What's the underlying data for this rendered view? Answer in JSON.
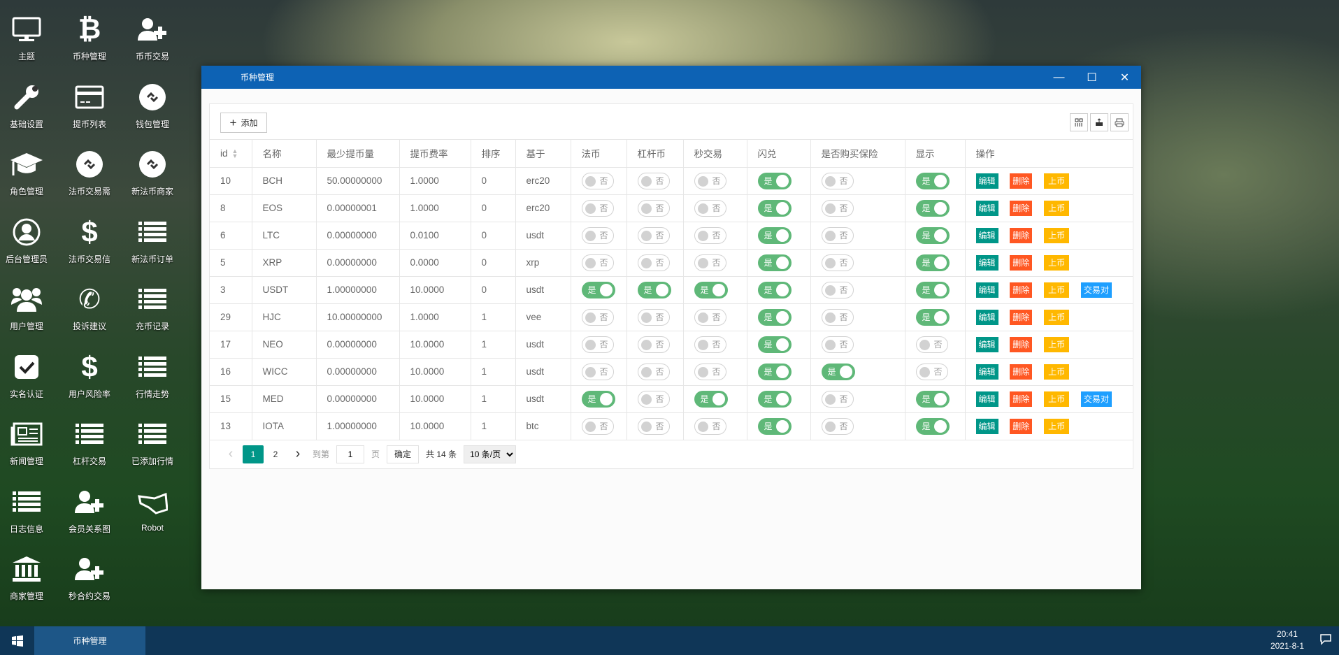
{
  "desktop": {
    "icons": [
      {
        "label": "主题",
        "icon": "monitor-icon"
      },
      {
        "label": "币种管理",
        "icon": "bitcoin-icon"
      },
      {
        "label": "币币交易",
        "icon": "user-plus-icon"
      },
      {
        "label": "基础设置",
        "icon": "wrench-icon"
      },
      {
        "label": "提币列表",
        "icon": "credit-card-icon"
      },
      {
        "label": "钱包管理",
        "icon": "link-circle-icon"
      },
      {
        "label": "角色管理",
        "icon": "graduation-cap-icon"
      },
      {
        "label": "法币交易需",
        "icon": "link-circle-icon"
      },
      {
        "label": "新法币商家",
        "icon": "link-circle-icon"
      },
      {
        "label": "后台管理员",
        "icon": "user-circle-icon"
      },
      {
        "label": "法币交易信",
        "icon": "dollar-icon"
      },
      {
        "label": "新法币订单",
        "icon": "list-icon"
      },
      {
        "label": "用户管理",
        "icon": "users-icon"
      },
      {
        "label": "投诉建议",
        "icon": "phone-icon"
      },
      {
        "label": "充币记录",
        "icon": "list-icon"
      },
      {
        "label": "实名认证",
        "icon": "check-square-icon"
      },
      {
        "label": "用户风险率",
        "icon": "dollar-icon"
      },
      {
        "label": "行情走势",
        "icon": "list-icon"
      },
      {
        "label": "新闻管理",
        "icon": "newspaper-icon"
      },
      {
        "label": "杠杆交易",
        "icon": "list-icon"
      },
      {
        "label": "已添加行情",
        "icon": "list-icon"
      },
      {
        "label": "日志信息",
        "icon": "list-icon"
      },
      {
        "label": "会员关系图",
        "icon": "user-plus-icon"
      },
      {
        "label": "Robot",
        "icon": "hand-icon"
      },
      {
        "label": "商家管理",
        "icon": "bank-icon"
      },
      {
        "label": "秒合约交易",
        "icon": "user-plus-icon"
      }
    ]
  },
  "window": {
    "title": "币种管理",
    "minimize": "—",
    "maximize": "☐",
    "close": "✕"
  },
  "toolbar": {
    "add_label": "添加",
    "add_icon": "plus-icon",
    "tools": [
      "columns-icon",
      "export-icon",
      "print-icon"
    ]
  },
  "table": {
    "columns": [
      "id",
      "名称",
      "最少提币量",
      "提币费率",
      "排序",
      "基于",
      "法币",
      "杠杆币",
      "秒交易",
      "闪兑",
      "是否购买保险",
      "显示",
      "操作"
    ],
    "toggle_on": "是",
    "toggle_off": "否",
    "actions": {
      "edit": "编辑",
      "delete": "删除",
      "list": "上币",
      "pair": "交易对"
    },
    "rows": [
      {
        "id": "10",
        "name": "BCH",
        "min": "50.00000000",
        "fee": "1.0000",
        "sort": "0",
        "base": "erc20",
        "toggles": [
          false,
          false,
          false,
          true,
          false,
          true
        ],
        "pair": false
      },
      {
        "id": "8",
        "name": "EOS",
        "min": "0.00000001",
        "fee": "1.0000",
        "sort": "0",
        "base": "erc20",
        "toggles": [
          false,
          false,
          false,
          true,
          false,
          true
        ],
        "pair": false
      },
      {
        "id": "6",
        "name": "LTC",
        "min": "0.00000000",
        "fee": "0.0100",
        "sort": "0",
        "base": "usdt",
        "toggles": [
          false,
          false,
          false,
          true,
          false,
          true
        ],
        "pair": false
      },
      {
        "id": "5",
        "name": "XRP",
        "min": "0.00000000",
        "fee": "0.0000",
        "sort": "0",
        "base": "xrp",
        "toggles": [
          false,
          false,
          false,
          true,
          false,
          true
        ],
        "pair": false
      },
      {
        "id": "3",
        "name": "USDT",
        "min": "1.00000000",
        "fee": "10.0000",
        "sort": "0",
        "base": "usdt",
        "toggles": [
          true,
          true,
          true,
          true,
          false,
          true
        ],
        "pair": true
      },
      {
        "id": "29",
        "name": "HJC",
        "min": "10.00000000",
        "fee": "1.0000",
        "sort": "1",
        "base": "vee",
        "toggles": [
          false,
          false,
          false,
          true,
          false,
          true
        ],
        "pair": false
      },
      {
        "id": "17",
        "name": "NEO",
        "min": "0.00000000",
        "fee": "10.0000",
        "sort": "1",
        "base": "usdt",
        "toggles": [
          false,
          false,
          false,
          true,
          false,
          false
        ],
        "pair": false
      },
      {
        "id": "16",
        "name": "WICC",
        "min": "0.00000000",
        "fee": "10.0000",
        "sort": "1",
        "base": "usdt",
        "toggles": [
          false,
          false,
          false,
          true,
          true,
          false
        ],
        "pair": false
      },
      {
        "id": "15",
        "name": "MED",
        "min": "0.00000000",
        "fee": "10.0000",
        "sort": "1",
        "base": "usdt",
        "toggles": [
          true,
          false,
          true,
          true,
          false,
          true
        ],
        "pair": true
      },
      {
        "id": "13",
        "name": "IOTA",
        "min": "1.00000000",
        "fee": "10.0000",
        "sort": "1",
        "base": "btc",
        "toggles": [
          false,
          false,
          false,
          true,
          false,
          true
        ],
        "pair": false
      }
    ]
  },
  "pager": {
    "prev": "‹",
    "pages": [
      "1",
      "2"
    ],
    "current": "1",
    "next": "›",
    "goto_label": "到第",
    "goto_value": "1",
    "page_unit": "页",
    "confirm": "确定",
    "total": "共 14 条",
    "page_size": "10 条/页"
  },
  "colors": {
    "titlebar": "#0d62b4",
    "edit": "#009688",
    "delete": "#ff5722",
    "list": "#ffb800",
    "pair": "#1e9fff",
    "toggle_on": "#5fb878"
  },
  "taskbar": {
    "task": "币种管理",
    "time": "20:41",
    "date": "2021-8-1"
  }
}
